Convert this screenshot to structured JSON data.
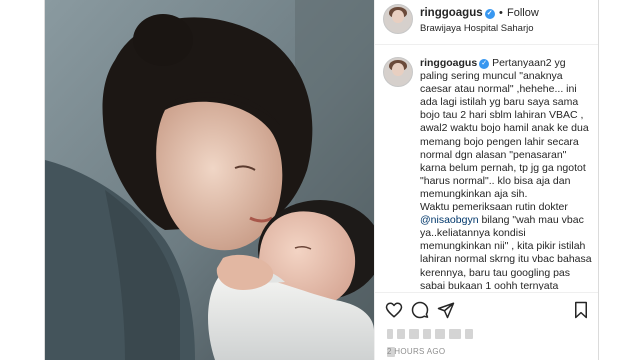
{
  "post": {
    "username": "ringgoagus",
    "follow_separator": "•",
    "follow_label": "Follow",
    "location": "Brawijaya Hospital Saharjo",
    "caption": {
      "author": "ringgoagus",
      "text_1": " Pertanyaan2 yg paling sering muncul \"anaknya caesar atau normal\" ,hehehe... ini ada lagi istilah yg baru saya sama bojo tau 2 hari sblm lahiran VBAC , awal2 waktu bojo hamil anak ke dua memang bojo pengen lahir secara normal dgn alasan \"penasaran\" karna belum pernah, tp jg ga ngotot \"harus normal\".. klo bisa aja dan memungkinkan aja sih.",
      "text_2a": "Waktu pemeriksaan rutin dokter ",
      "mention": "@nisaobgyn",
      "text_2b": " bilang \"wah mau vbac ya..keliatannya kondisi memungkinkan nii\" , kita pikir istilah lahiran normal skrng itu vbac bahasa kerennya, baru tau googling pas sabai bukaan 1 oohh ternyata artinya itu toh, tanpa ada persiapan sblmnya yg"
    },
    "time_ago": "2 HOURS AGO",
    "icons": [
      "heart-icon",
      "comment-icon",
      "share-icon",
      "bookmark-icon"
    ],
    "colors": {
      "verified": "#3897f0",
      "mention": "#00376b",
      "muted": "#8e8e8e"
    }
  }
}
